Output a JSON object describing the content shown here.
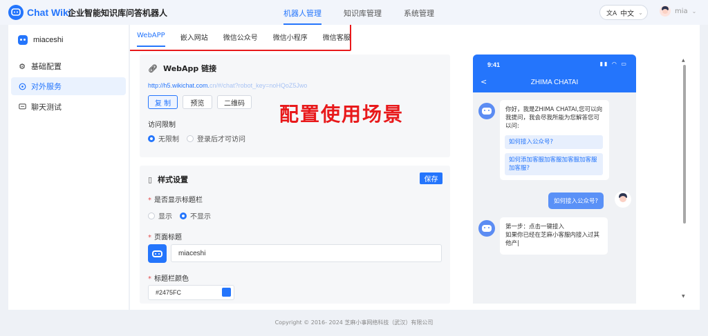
{
  "header": {
    "logo_text": "Chat Wiki",
    "app_title": "企业智能知识库问答机器人",
    "nav": [
      "机器人管理",
      "知识库管理",
      "系统管理"
    ],
    "lang_label": "中文",
    "user_name": "mia"
  },
  "sidebar": {
    "robot_name": "miaceshi",
    "items": [
      {
        "label": "基础配置",
        "icon": "gear-icon"
      },
      {
        "label": "对外服务",
        "icon": "share-icon"
      },
      {
        "label": "聊天测试",
        "icon": "chat-icon"
      }
    ],
    "active": 1
  },
  "subtabs": [
    "WebAPP",
    "嵌入网站",
    "微信公众号",
    "微信小程序",
    "微信客服"
  ],
  "webapp_card": {
    "title": "WebApp 链接",
    "url": "http://h5.wikichat.com.",
    "url_blurred": "cn/#/chat?robot_key=noHQoZ5Jwo",
    "buttons": [
      "复 制",
      "预览",
      "二维码"
    ],
    "access_label": "访问限制",
    "access_options": [
      "无限制",
      "登录后才可访问"
    ],
    "access_selected": 0
  },
  "annotation": "配置使用场景",
  "style_card": {
    "title": "样式设置",
    "save_label": "保存",
    "show_title_label": "是否显示标题栏",
    "show_title_options": [
      "显示",
      "不显示"
    ],
    "show_title_selected": 1,
    "page_title_label": "页面标题",
    "page_title_value": "miaceshi",
    "title_color_label": "标题栏颜色",
    "title_color_value": "#2475FC"
  },
  "preview": {
    "time": "9:41",
    "title": "ZHIMA CHATAI",
    "welcome": "你好，我是ZHIMA CHATAI,您可以向我提问，我会尽我所能为您解答您可以问:",
    "suggestions": [
      "如何接入公众号?",
      "如何添加客服加客服加客服加客服加客服?"
    ],
    "user_question": "如何接入公众号?",
    "answer_line1": "第一步：点击一键接入",
    "answer_line2": "如果你已经在芝麻小客服内接入过其他产|"
  },
  "footer": "Copyright © 2016- 2024 芝麻小事网络科技（武汉）有限公司",
  "colors": {
    "accent": "#2475FC",
    "annotation": "#E8191B"
  }
}
